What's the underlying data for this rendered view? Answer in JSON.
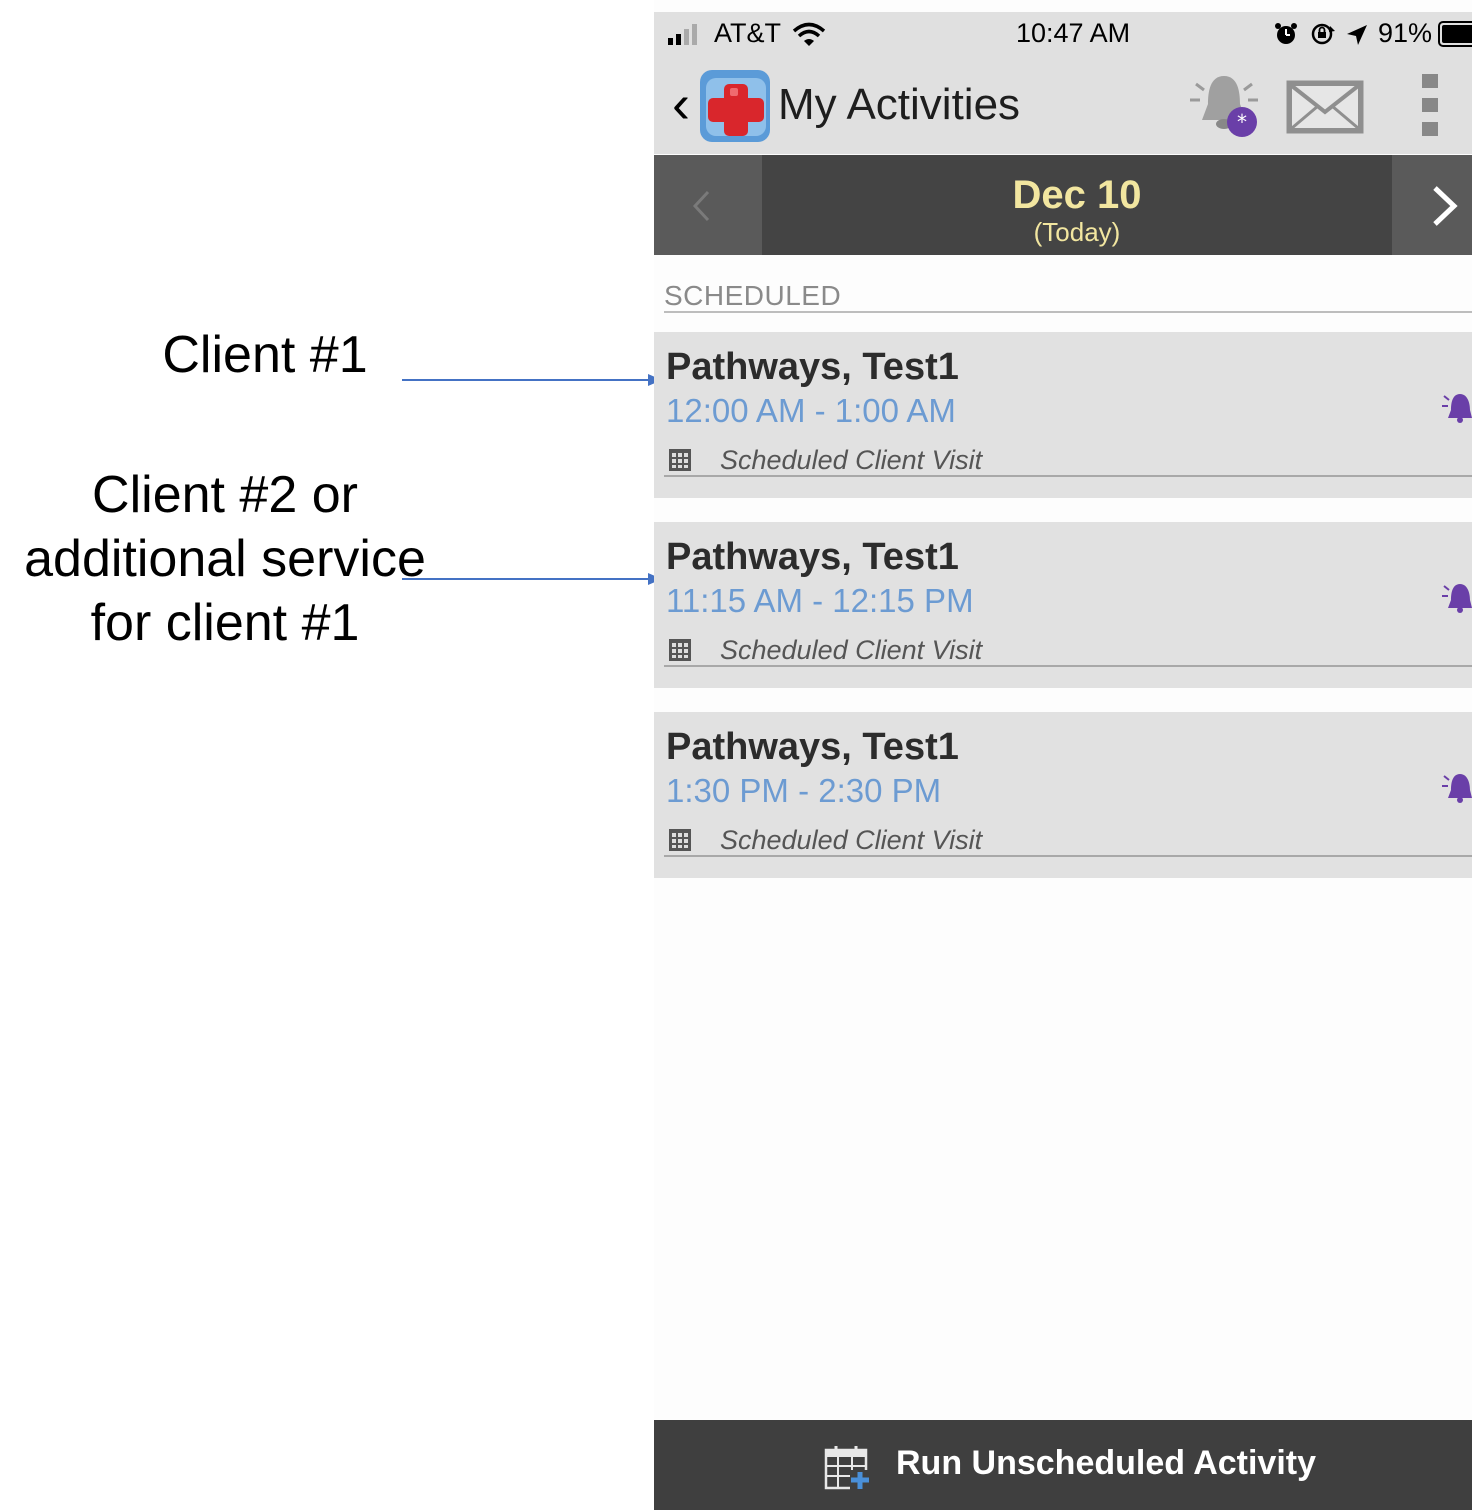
{
  "annotations": {
    "client1": "Client #1",
    "client2": "Client #2 or additional service for client #1"
  },
  "status_bar": {
    "carrier": "AT&T",
    "time": "10:47 AM",
    "battery": "91%"
  },
  "header": {
    "title": "My Activities",
    "back_glyph": "‹"
  },
  "date_nav": {
    "date": "Dec 10",
    "subtitle": "(Today)"
  },
  "section": {
    "label": "SCHEDULED"
  },
  "activities": [
    {
      "name": "Pathways, Test1",
      "time": "12:00 AM - 1:00 AM",
      "type": "Scheduled Client Visit"
    },
    {
      "name": "Pathways, Test1",
      "time": "11:15 AM - 12:15 PM",
      "type": "Scheduled Client Visit"
    },
    {
      "name": "Pathways, Test1",
      "time": "1:30 PM - 2:30 PM",
      "type": "Scheduled Client Visit"
    }
  ],
  "bottom": {
    "action_label": "Run Unscheduled Activity"
  },
  "colors": {
    "time_blue": "#6c9bd2",
    "date_yellow": "#f2e6a0",
    "bell_purple": "#6a3fa8",
    "arrow_blue": "#4472c4"
  }
}
